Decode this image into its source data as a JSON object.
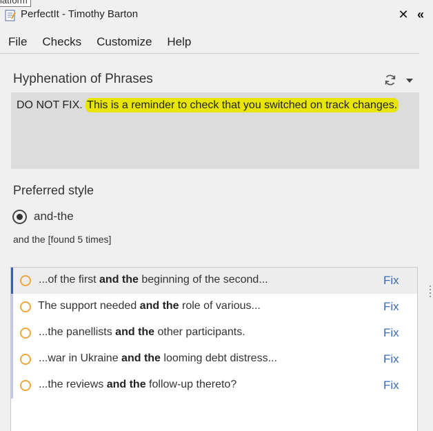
{
  "tooltip": {
    "text": "latform"
  },
  "window": {
    "title": "PerfectIt - Timothy Barton",
    "close_icon": "close-icon",
    "collapse_icon": "double-chevron-left-icon"
  },
  "menu": {
    "items": [
      "File",
      "Checks",
      "Customize",
      "Help"
    ]
  },
  "check": {
    "title": "Hyphenation of Phrases",
    "message_plain": "DO NOT FIX.",
    "message_highlighted": "This is a reminder to check that you switched on track changes.",
    "highlight_color": "#e8e600"
  },
  "preferred": {
    "label": "Preferred style",
    "option": "and-the",
    "found_text": "and the [found 5 times]"
  },
  "results": [
    {
      "before": "...of the first ",
      "bold": "and the",
      "after": " beginning of the second...",
      "fix": "Fix",
      "selected": true
    },
    {
      "before": "The support needed ",
      "bold": "and the",
      "after": " role of various...",
      "fix": "Fix",
      "selected": false
    },
    {
      "before": "...the panellists ",
      "bold": "and the",
      "after": " other participants.",
      "fix": "Fix",
      "selected": false
    },
    {
      "before": "...war in Ukraine ",
      "bold": "and the",
      "after": " looming debt distress...",
      "fix": "Fix",
      "selected": false
    },
    {
      "before": "...the reviews ",
      "bold": "and the",
      "after": " follow-up thereto?",
      "fix": "Fix",
      "selected": false
    }
  ],
  "colors": {
    "accent_link": "#3a6db5",
    "radio_orange": "#f0a640",
    "selected_marker": "#3d5fa8"
  }
}
